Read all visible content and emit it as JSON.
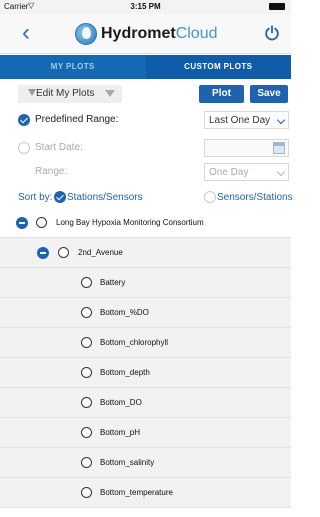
{
  "status_bar": {
    "carrier": "Carrier",
    "time": "3:15 PM"
  },
  "nav": {
    "brand_main": "Hydromet",
    "brand_suffix": "Cloud"
  },
  "tabs": [
    {
      "label": "MY PLOTS",
      "active": false
    },
    {
      "label": "CUSTOM PLOTS",
      "active": true
    }
  ],
  "toolbar": {
    "edit_label": "Edit My Plots",
    "plot_label": "Plot",
    "save_label": "Save"
  },
  "form": {
    "predefined_range_label": "Predefined Range:",
    "predefined_range_value": "Last One Day",
    "start_date_label": "Start Date:",
    "range_label": "Range:",
    "range_value": "One Day"
  },
  "sort": {
    "label": "Sort by:",
    "option1": "Stations/Sensors",
    "option2": "Sensors/Stations"
  },
  "tree": {
    "group": "Long Bay Hypoxia Monitoring Consortium",
    "station": "2nd_Avenue",
    "sensors": [
      "Battery",
      "Bottom_%DO",
      "Bottom_chlorophyll",
      "Bottom_depth",
      "Bottom_DO",
      "Bottom_pH",
      "Bottom_salinity",
      "Bottom_temperature"
    ]
  },
  "colors": {
    "accent": "#1f63b0",
    "tab_bar": "#1f6fb7"
  }
}
